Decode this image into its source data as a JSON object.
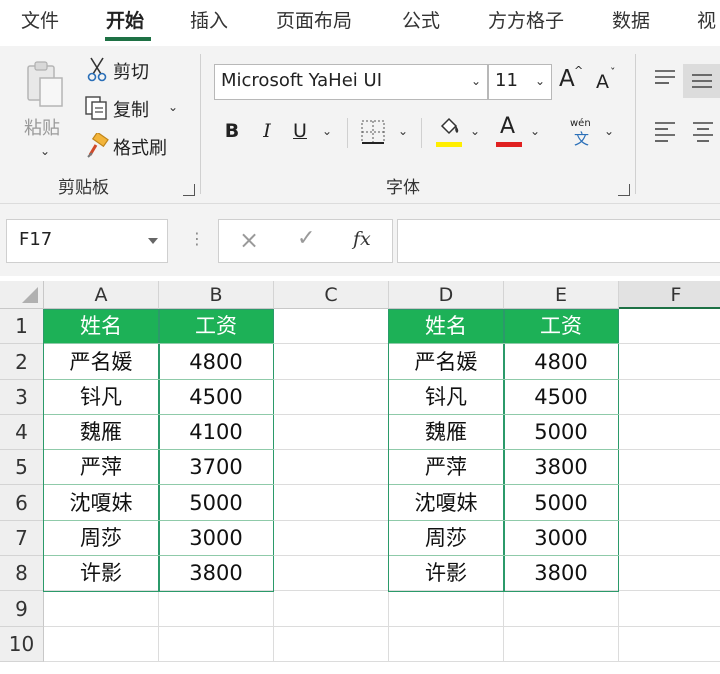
{
  "menu": {
    "tabs": [
      {
        "label": "文件"
      },
      {
        "label": "开始"
      },
      {
        "label": "插入"
      },
      {
        "label": "页面布局"
      },
      {
        "label": "公式"
      },
      {
        "label": "方方格子"
      },
      {
        "label": "数据"
      },
      {
        "label": "视"
      }
    ],
    "active_tab": "开始"
  },
  "ribbon": {
    "clipboard": {
      "paste_label": "粘贴",
      "cut_label": "剪切",
      "copy_label": "复制",
      "format_painter_label": "格式刷",
      "group_label": "剪贴板"
    },
    "font": {
      "font_name": "Microsoft YaHei UI",
      "font_size": "11",
      "bold": "B",
      "italic": "I",
      "underline": "U",
      "font_color_letter": "A",
      "grow_font": "A",
      "shrink_font": "A",
      "phonetic_top": "wén",
      "phonetic_bottom": "文",
      "group_label": "字体",
      "highlight_color": "#ffee00",
      "font_color": "#e02020"
    }
  },
  "formula_bar": {
    "name_box": "F17",
    "cancel_icon": "×",
    "enter_icon": "✓",
    "fx_label": "fx",
    "formula": ""
  },
  "sheet": {
    "columns": [
      "A",
      "B",
      "C",
      "D",
      "E",
      "F"
    ],
    "rows": [
      "1",
      "2",
      "3",
      "4",
      "5",
      "6",
      "7",
      "8",
      "9",
      "10"
    ],
    "header_color": "#1db157",
    "table_left": {
      "headers": [
        "姓名",
        "工资"
      ],
      "rows": [
        [
          "严名媛",
          "4800"
        ],
        [
          "钭凡",
          "4500"
        ],
        [
          "魏雁",
          "4100"
        ],
        [
          "严萍",
          "3700"
        ],
        [
          "沈嗄妹",
          "5000"
        ],
        [
          "周莎",
          "3000"
        ],
        [
          "许影",
          "3800"
        ]
      ]
    },
    "table_right": {
      "headers": [
        "姓名",
        "工资"
      ],
      "rows": [
        [
          "严名媛",
          "4800"
        ],
        [
          "钭凡",
          "4500"
        ],
        [
          "魏雁",
          "5000"
        ],
        [
          "严萍",
          "3800"
        ],
        [
          "沈嗄妹",
          "5000"
        ],
        [
          "周莎",
          "3000"
        ],
        [
          "许影",
          "3800"
        ]
      ]
    }
  }
}
